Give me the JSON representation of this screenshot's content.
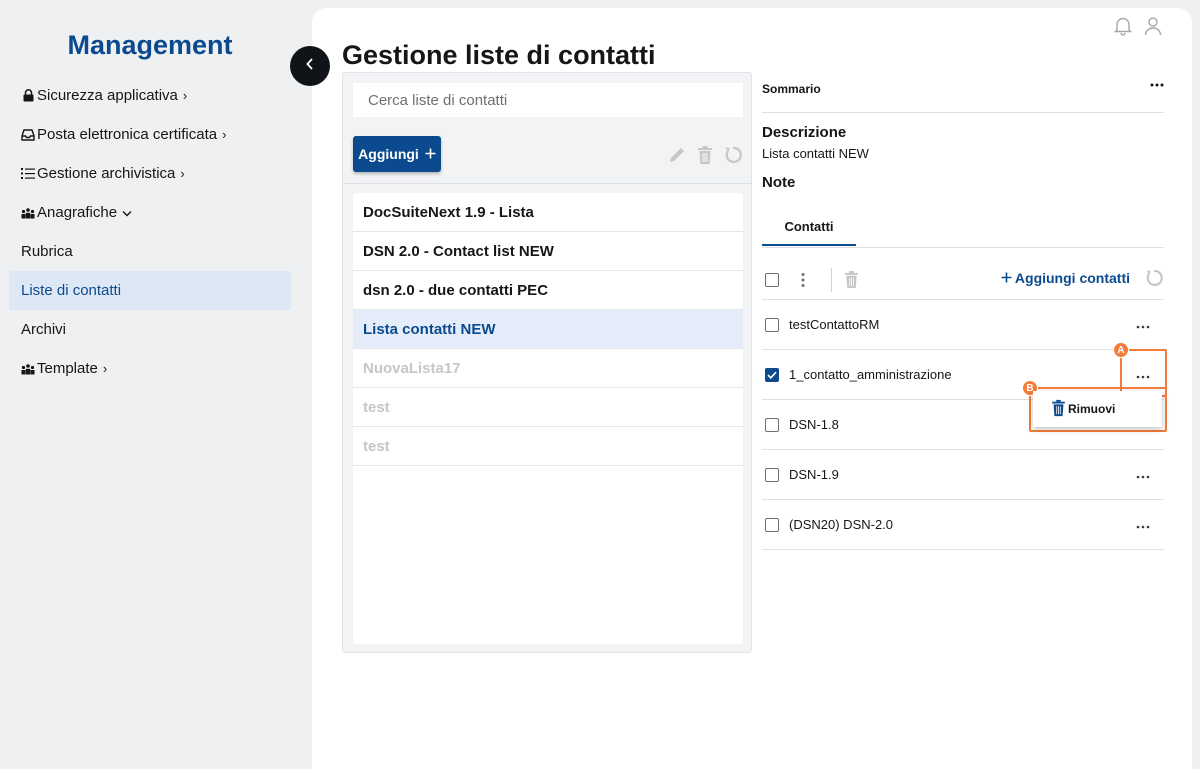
{
  "sidebar": {
    "brand": "Management",
    "items": [
      {
        "label": "Sicurezza applicativa",
        "icon": "lock-icon",
        "chevron": "›"
      },
      {
        "label": "Posta elettronica certificata",
        "icon": "inbox-icon",
        "chevron": "›"
      },
      {
        "label": "Gestione archivistica",
        "icon": "list-icon",
        "chevron": "›"
      },
      {
        "label": "Anagrafiche",
        "icon": "group-icon",
        "chevron": "⌄"
      },
      {
        "label": "Rubrica"
      },
      {
        "label": "Liste di contatti",
        "active": true
      },
      {
        "label": "Archivi"
      },
      {
        "label": "Template",
        "icon": "group-icon",
        "chevron": "›"
      }
    ]
  },
  "header": {
    "title": "Gestione liste di contatti",
    "icons": [
      "bell-icon",
      "user-icon"
    ]
  },
  "lists_panel": {
    "search_placeholder": "Cerca liste di contatti",
    "add_label": "Aggiungi",
    "tools": [
      "edit-icon",
      "trash-icon",
      "refresh-icon"
    ],
    "items": [
      {
        "label": "DocSuiteNext 1.9 - Lista",
        "state": "normal"
      },
      {
        "label": "DSN 2.0 - Contact list NEW",
        "state": "normal"
      },
      {
        "label": "dsn 2.0 - due contatti PEC",
        "state": "normal"
      },
      {
        "label": "Lista contatti NEW",
        "state": "selected"
      },
      {
        "label": "NuovaLista17",
        "state": "disabled"
      },
      {
        "label": "test",
        "state": "disabled"
      },
      {
        "label": "test",
        "state": "disabled"
      }
    ]
  },
  "summary": {
    "title": "Sommario",
    "description_label": "Descrizione",
    "description_value": "Lista contatti NEW",
    "note_label": "Note",
    "tab_label": "Contatti",
    "add_contacts_label": "Aggiungi contatti",
    "contacts": [
      {
        "name": "testContattoRM",
        "checked": false
      },
      {
        "name": "1_contatto_amministrazione",
        "checked": true
      },
      {
        "name": "DSN-1.8",
        "checked": false
      },
      {
        "name": "DSN-1.9",
        "checked": false
      },
      {
        "name": "(DSN20) DSN-2.0",
        "checked": false
      }
    ]
  },
  "context_menu": {
    "remove_label": "Rimuovi"
  },
  "markers": {
    "a": "A",
    "b": "B"
  },
  "colors": {
    "brand": "#0b4a8f",
    "selected_bg": "#e4edf9",
    "highlight": "#f47c3c"
  }
}
